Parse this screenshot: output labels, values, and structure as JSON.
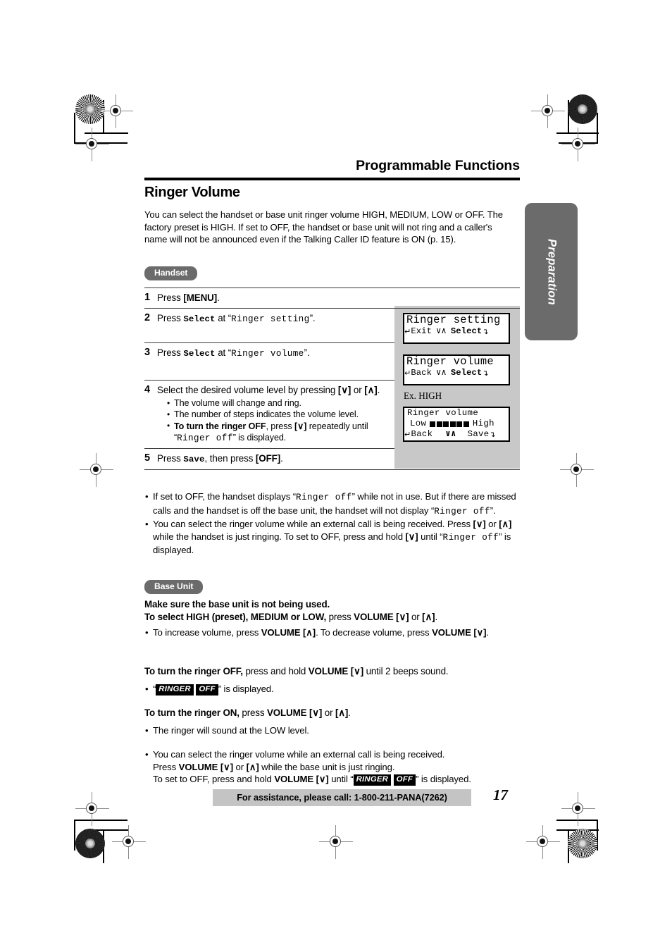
{
  "header": {
    "running_head": "Programmable Functions",
    "section_title": "Ringer Volume"
  },
  "intro": "You can select the handset or base unit ringer volume HIGH, MEDIUM, LOW or OFF. The factory preset is HIGH. If set to OFF, the handset or base unit will not ring and a caller's name will not be announced even if the Talking Caller ID feature is ON (p. 15).",
  "side_tab": {
    "label": "Preparation"
  },
  "badges": {
    "handset": "Handset",
    "base_unit": "Base Unit"
  },
  "steps": [
    {
      "num": "1",
      "pre": "Press ",
      "kbd": "[MENU]",
      "post": "."
    },
    {
      "num": "2",
      "pre": "Press ",
      "cmd": "Select",
      "mid": " at “",
      "mono": "Ringer setting",
      "post": "”."
    },
    {
      "num": "3",
      "pre": "Press ",
      "cmd": "Select",
      "mid": " at “",
      "mono": "Ringer volume",
      "post": "”."
    },
    {
      "num": "4",
      "text_a": "Select the desired volume level by pressing ",
      "key_down": "[∨]",
      "text_b": " or ",
      "key_up": "[∧]",
      "text_c": ".",
      "bullets": [
        {
          "plain": "The volume will change and ring."
        },
        {
          "plain": "The number of steps indicates the volume level."
        },
        {
          "bold": "To turn the ringer OFF",
          "mid": ", press ",
          "key": "[∨]",
          "after": " repeatedly until “",
          "mono": "Ringer off",
          "tail": "” is displayed."
        }
      ]
    },
    {
      "num": "5",
      "pre": "Press ",
      "cmd": "Save",
      "mid": ", then press ",
      "kbd": "[OFF]",
      "post": "."
    }
  ],
  "lcds": {
    "ex_label": "Ex. HIGH",
    "screen1": {
      "line1": "Ringer setting",
      "soft_left": "Exit",
      "soft_mid": "∨∧",
      "soft_right": "Select",
      "arrow_left": "↵",
      "arrow_right": "↴"
    },
    "screen2": {
      "line1": "Ringer volume",
      "soft_left": "Back",
      "soft_mid": "∨∧",
      "soft_right": "Select",
      "arrow_left": "↵",
      "arrow_right": "↴"
    },
    "screen3": {
      "line1": "Ringer volume",
      "low_label": "Low",
      "high_label": "High",
      "bars_filled": 6,
      "soft_left": "Back",
      "soft_mid": "∨∧",
      "soft_right": "Save",
      "arrow_left": "↵",
      "arrow_right": "↴"
    }
  },
  "handset_notes": [
    {
      "a": "If set to OFF, the handset displays “",
      "m1": "Ringer off",
      "b": "” while not in use. But if there are missed calls and the handset is off the base unit, the handset will not display “",
      "m2": "Ringer off",
      "c": "”."
    },
    {
      "a": "You can select the ringer volume while an external call is being received. Press ",
      "k1": "[∨]",
      "b": " or ",
      "k2": "[∧]",
      "c": " while the handset is just ringing. To set to OFF, press and hold ",
      "k3": "[∨]",
      "d": " until “",
      "m1": "Ringer off",
      "e": "” is displayed."
    }
  ],
  "base_unit": {
    "line1": "Make sure the base unit is not being used.",
    "line2_bold": "To select HIGH (preset), MEDIUM or LOW,",
    "line2_reg": " press ",
    "line2_vol": "VOLUME",
    "line2_k1": "[∨]",
    "line2_or": " or ",
    "line2_k2": "[∧]",
    "line2_end": ".",
    "bullet1_a": "To increase volume, press ",
    "bullet1_vol": "VOLUME",
    "bullet1_k1": "[∧]",
    "bullet1_b": ". To decrease volume, press ",
    "bullet1_vol2": "VOLUME",
    "bullet1_k2": "[∨]",
    "bullet1_c": ".",
    "off_bold": "To turn the ringer OFF,",
    "off_reg1": " press and hold ",
    "off_vol": "VOLUME",
    "off_k": "[∨]",
    "off_reg2": " until 2 beeps sound.",
    "off_bullet_pre": "“",
    "off_badge1": "RINGER",
    "off_badge2": "OFF",
    "off_bullet_post": "” is displayed.",
    "on_bold": "To turn the ringer ON,",
    "on_reg": " press ",
    "on_vol": "VOLUME",
    "on_k1": "[∨]",
    "on_or": " or ",
    "on_k2": "[∧]",
    "on_end": ".",
    "on_bullet": "The ringer will sound at the LOW level.",
    "ext_line1": "You can select the ringer volume while an external call is being received.",
    "ext_line2_a": "Press ",
    "ext_line2_vol": "VOLUME",
    "ext_line2_k1": "[∨]",
    "ext_line2_or": " or ",
    "ext_line2_k2": "[∧]",
    "ext_line2_b": " while the base unit is just ringing.",
    "ext_line3_a": "To set to OFF, press and hold ",
    "ext_line3_vol": "VOLUME",
    "ext_line3_k": "[∨]",
    "ext_line3_b": " until “",
    "ext_badge1": "RINGER",
    "ext_badge2": "OFF",
    "ext_line3_c": "” is displayed."
  },
  "footer": {
    "assistance": "For assistance, please call: 1-800-211-PANA(7262)",
    "page_number": "17"
  },
  "colors": {
    "badge_gray": "#6b6b6b",
    "lcd_panel_gray": "#c8c8c8",
    "assist_gray": "#c4c4c4"
  }
}
